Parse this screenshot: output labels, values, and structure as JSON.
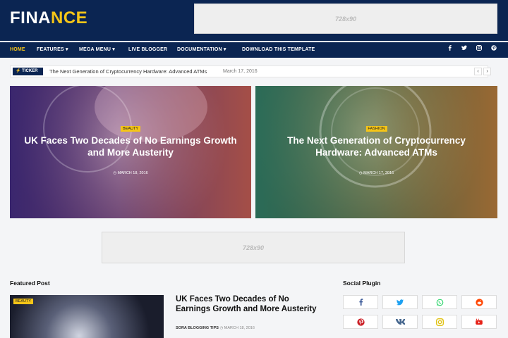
{
  "logo": {
    "part1": "FINA",
    "part2": "NCE"
  },
  "ads": {
    "top": "728x90",
    "middle": "728x90"
  },
  "nav": {
    "items": [
      "HOME",
      "FEATURES ▾",
      "MEGA MENU ▾",
      "LIVE BLOGGER",
      "DOCUMENTATION ▾",
      "DOWNLOAD THIS TEMPLATE"
    ],
    "social": [
      "facebook-icon",
      "twitter-icon",
      "instagram-icon",
      "pinterest-icon"
    ]
  },
  "ticker": {
    "label": "TICKER",
    "title": "The Next Generation of Cryptocurrency Hardware: Advanced ATMs",
    "date": "March 17, 2016",
    "prev": "‹",
    "next": "›"
  },
  "hero": [
    {
      "category": "BEAUTY",
      "title": "UK Faces Two Decades of No Earnings Growth and More Austerity",
      "date": "◷ MARCH 18, 2016"
    },
    {
      "category": "FASHION",
      "title": "The Next Generation of Cryptocurrency Hardware: Advanced ATMs",
      "date": "◷ MARCH 17, 2016"
    }
  ],
  "featured": {
    "section_title": "Featured Post",
    "category": "BEAUTY",
    "title": "UK Faces Two Decades of No Earnings Growth and More Austerity",
    "author": "SORA BLOGGING TIPS",
    "date": "◷ MARCH 18, 2016"
  },
  "social_plugin": {
    "title": "Social Plugin",
    "buttons": [
      {
        "icon": "facebook-icon",
        "color": "#3b5998"
      },
      {
        "icon": "twitter-icon",
        "color": "#1da1f2"
      },
      {
        "icon": "whatsapp-icon",
        "color": "#25d366"
      },
      {
        "icon": "reddit-icon",
        "color": "#ff4500"
      },
      {
        "icon": "pinterest-icon",
        "color": "#cb2027"
      },
      {
        "icon": "vk-icon",
        "color": "#45668e"
      },
      {
        "icon": "instagram-icon",
        "color": "#e1c319"
      },
      {
        "icon": "youtube-icon",
        "color": "#e62117"
      }
    ]
  },
  "colors": {
    "brand": "#0b2552",
    "accent": "#f5c518"
  }
}
